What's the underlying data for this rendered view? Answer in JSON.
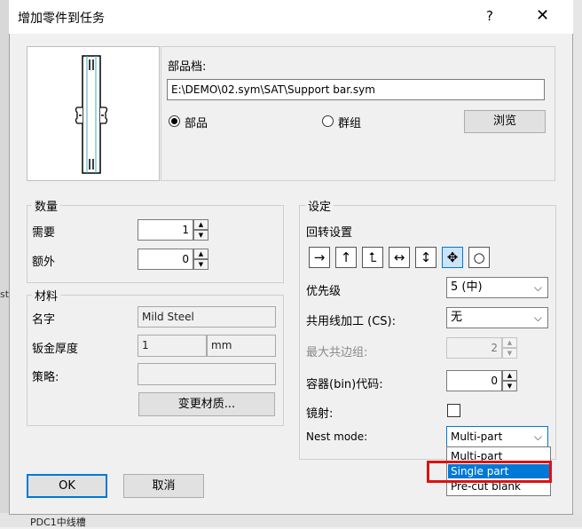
{
  "background": {
    "left_text": "st",
    "bottom_text": "PDC1中线槽"
  },
  "dialog": {
    "title": "增加零件到任务",
    "help_label": "?",
    "close_label": "✕",
    "part_file_label": "部品档:",
    "part_file_path": "E:\\DEMO\\02.sym\\SAT\\Support bar.sym",
    "radio_part": "部品",
    "radio_group": "群组",
    "browse_label": "浏览",
    "ok_label": "OK",
    "cancel_label": "取消"
  },
  "quantity": {
    "title": "数量",
    "required_label": "需要",
    "required_value": "1",
    "extra_label": "额外",
    "extra_value": "0"
  },
  "material": {
    "title": "材料",
    "name_label": "名字",
    "name_value": "Mild Steel",
    "thickness_label": "钣金厚度",
    "thickness_value": "1",
    "thickness_unit": "mm",
    "strategy_label": "策略:",
    "strategy_value": "",
    "change_button": "变更材质..."
  },
  "settings": {
    "title": "设定",
    "rotation_label": "回转设置",
    "rotation_icons": [
      "arrow-right-icon",
      "arrow-up-icon",
      "arrow-up-right-corner-icon",
      "arrow-left-right-icon",
      "arrow-up-down-icon",
      "arrows-four-way-icon",
      "circle-icon"
    ],
    "rotation_glyphs": [
      "→",
      "↑",
      "⮤",
      "↔",
      "↕",
      "✥",
      "○"
    ],
    "priority_label": "优先级",
    "priority_value": "5 (中)",
    "common_line_label": "共用线加工 (CS):",
    "common_line_value": "无",
    "max_common_edge_label": "最大共边组:",
    "max_common_edge_value": "2",
    "bin_code_label": "容器(bin)代码:",
    "bin_code_value": "0",
    "mirror_label": "镜射:",
    "nest_mode_label": "Nest mode:",
    "nest_mode_value": "Multi-part",
    "nest_mode_options": [
      "Multi-part",
      "Single part",
      "Pre-cut blank"
    ],
    "nest_mode_highlighted": "Single part"
  },
  "colors": {
    "accent": "#0078d7",
    "highlight_box": "#e01010"
  }
}
